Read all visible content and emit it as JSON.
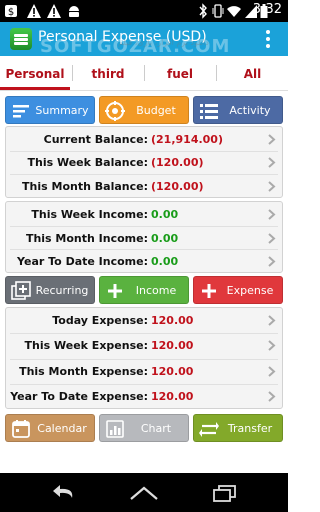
{
  "status_bar": {
    "time": "3:32",
    "left_icons": [
      "dollar-icon",
      "warning-icon",
      "warning-icon",
      "android-icon"
    ],
    "right_icons": [
      "bluetooth-icon",
      "vibrate-icon",
      "wifi-icon",
      "signal-icon",
      "battery-icon"
    ]
  },
  "action_bar": {
    "title": "Personal Expense (USD)",
    "watermark": "SOFTGOZAR.COM",
    "watermark_sub": "دانلود نرم افزار، بازی، فیلم",
    "overflow_icon": "overflow-menu-icon",
    "color": "#1ba2d9"
  },
  "tabs": [
    {
      "label": "Personal",
      "active": true
    },
    {
      "label": "third",
      "active": false
    },
    {
      "label": "fuel",
      "active": false
    },
    {
      "label": "All",
      "active": false
    }
  ],
  "top_buttons": [
    {
      "label": "Summary",
      "icon": "list-icon",
      "color": "#3d8fe0"
    },
    {
      "label": "Budget",
      "icon": "target-icon",
      "color": "#f39a25"
    },
    {
      "label": "Activity",
      "icon": "list-icon",
      "color": "#4d6aa4"
    }
  ],
  "balance": [
    {
      "label": "Current Balance:",
      "value": "(21,914.00)"
    },
    {
      "label": "This Week Balance:",
      "value": "(120.00)"
    },
    {
      "label": "This Month Balance:",
      "value": "(120.00)"
    }
  ],
  "income": [
    {
      "label": "This Week Income:",
      "value": "0.00"
    },
    {
      "label": "This Month Income:",
      "value": "0.00"
    },
    {
      "label": "Year To Date Income:",
      "value": "0.00"
    }
  ],
  "mid_buttons": [
    {
      "label": "Recurring",
      "icon": "add-box-icon",
      "color": "#6a6f76"
    },
    {
      "label": "Income",
      "icon": "plus-icon",
      "color": "#5ab23f"
    },
    {
      "label": "Expense",
      "icon": "plus-icon",
      "color": "#e0383c"
    }
  ],
  "expense": [
    {
      "label": "Today Expense:",
      "value": "120.00"
    },
    {
      "label": "This Week Expense:",
      "value": "120.00"
    },
    {
      "label": "This Month Expense:",
      "value": "120.00"
    },
    {
      "label": "Year To Date Expense:",
      "value": "120.00"
    }
  ],
  "bottom_buttons": [
    {
      "label": "Calendar",
      "icon": "calendar-icon",
      "color": "#c9955e"
    },
    {
      "label": "Chart",
      "icon": "chart-icon",
      "color": "#b7b9bd"
    },
    {
      "label": "Transfer",
      "icon": "transfer-icon",
      "color": "#83a92a"
    }
  ],
  "nav_bar": [
    "back-icon",
    "home-icon",
    "recent-apps-icon"
  ]
}
